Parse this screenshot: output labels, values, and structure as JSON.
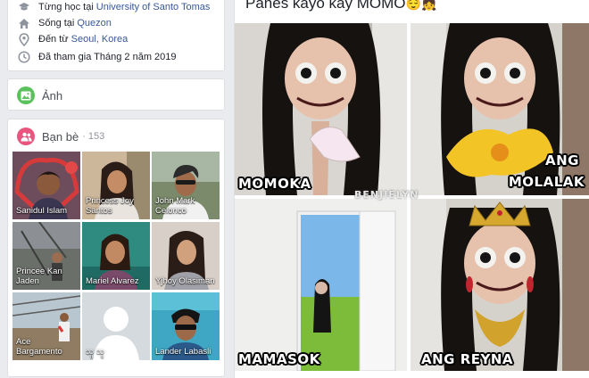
{
  "intro": {
    "studied_prefix": "Từng học tại",
    "studied_place": "University of Santo Tomas",
    "lives_prefix": "Sống tại",
    "lives_place": "Quezon",
    "from_prefix": "Đến từ",
    "from_place": "Seoul, Korea",
    "joined": "Đã tham gia Tháng 2 năm 2019"
  },
  "photos": {
    "title": "Ảnh",
    "icon": "photos-icon"
  },
  "friends": {
    "title": "Bạn bè",
    "count": "· 153",
    "items": [
      {
        "name": "Sanidul Islam"
      },
      {
        "name": "Princess Joy Santos"
      },
      {
        "name": "John Mark Celonco"
      },
      {
        "name": "Princee Kan Jaden"
      },
      {
        "name": "Mariel Alvarez"
      },
      {
        "name": "Yjhoy Olasiman"
      },
      {
        "name": "Ace Bargamento"
      },
      {
        "name": "သူ သူ"
      },
      {
        "name": "Lander Labasli"
      }
    ]
  },
  "post": {
    "text": "Panes kayo kay MOMO",
    "emojis": "😌👧",
    "captions": {
      "top_left": "MOMOKA",
      "top_right_1": "ANG",
      "top_right_2": "MOLALAK",
      "bottom_left": "MAMASOK",
      "bottom_right": "ANG REYNA",
      "watermark": "BENJIELYN"
    }
  },
  "colors": {
    "link": "#385898",
    "page_bg": "#e9ebee",
    "photos_icon_bg": "#5ac15c",
    "friends_icon_bg": "#e8557e"
  }
}
